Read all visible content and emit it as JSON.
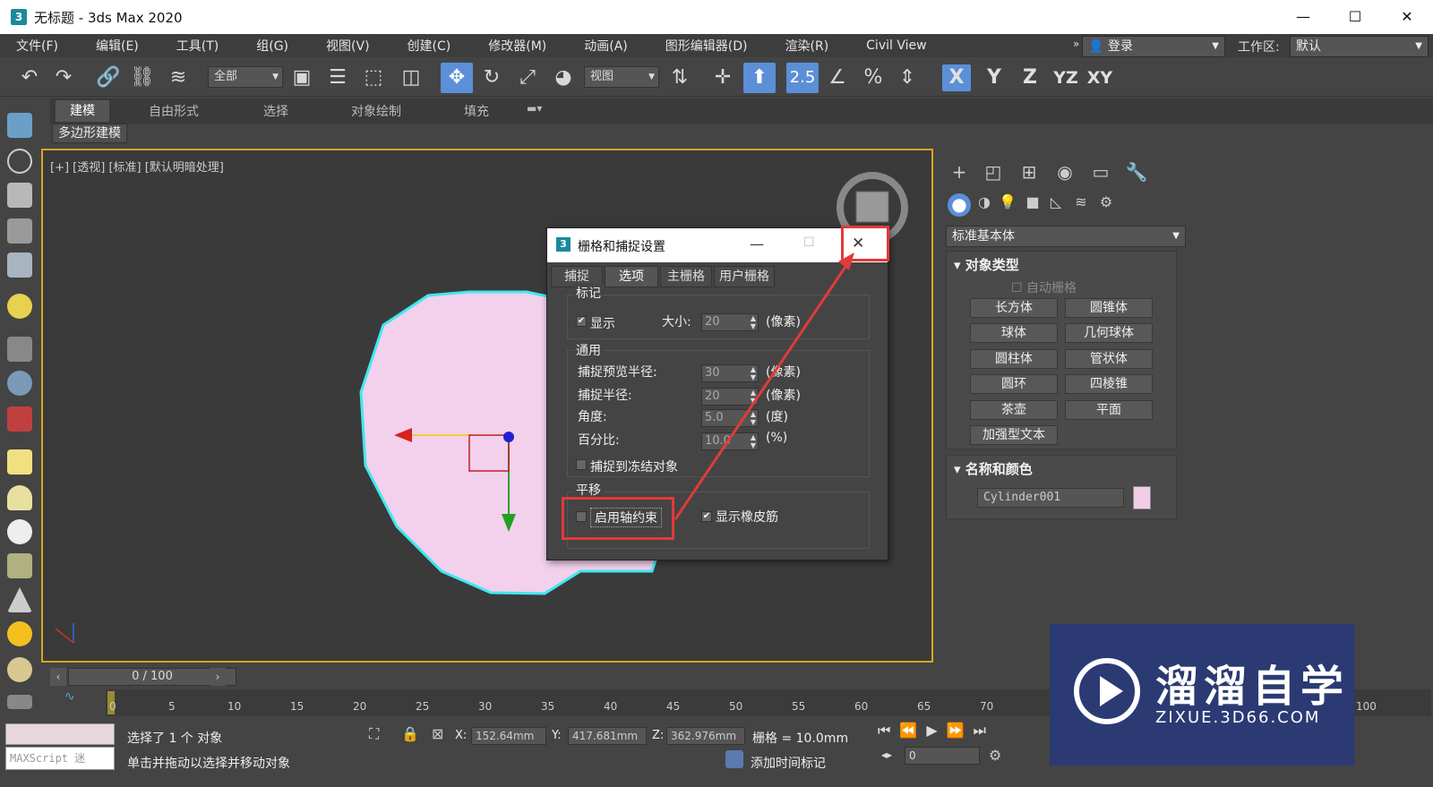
{
  "window": {
    "title": "无标题 - 3ds Max 2020",
    "app_icon": "3"
  },
  "menu": [
    "文件(F)",
    "编辑(E)",
    "工具(T)",
    "组(G)",
    "视图(V)",
    "创建(C)",
    "修改器(M)",
    "动画(A)",
    "图形编辑器(D)",
    "渲染(R)",
    "Civil View"
  ],
  "login": "登录",
  "workspace": {
    "label": "工作区:",
    "value": "默认"
  },
  "toolbar": {
    "selection_filter": "全部",
    "ref_coord": "视图",
    "snap_value": "2.5"
  },
  "axes": [
    "X",
    "Y",
    "Z",
    "YZ",
    "XY"
  ],
  "ribbon": {
    "tabs": [
      "建模",
      "自由形式",
      "选择",
      "对象绘制",
      "填充"
    ],
    "sub": "多边形建模"
  },
  "viewport": {
    "label": "[+] [透视] [标准] [默认明暗处理]"
  },
  "command_panel": {
    "category": "标准基本体",
    "object_type": {
      "header": "对象类型",
      "autogrid": "自动栅格",
      "buttons": [
        "长方体",
        "圆锥体",
        "球体",
        "几何球体",
        "圆柱体",
        "管状体",
        "圆环",
        "四棱锥",
        "茶壶",
        "平面",
        "加强型文本"
      ]
    },
    "name_color": {
      "header": "名称和颜色",
      "name": "Cylinder001",
      "color": "#f3cde8"
    }
  },
  "dialog": {
    "title": "栅格和捕捉设置",
    "tabs": [
      "捕捉",
      "选项",
      "主栅格",
      "用户栅格"
    ],
    "markers": {
      "group": "标记",
      "display_label": "显示",
      "display_checked": true,
      "size_label": "大小:",
      "size_value": "20",
      "size_unit": "(像素)"
    },
    "general": {
      "group": "通用",
      "preview_radius_label": "捕捉预览半径:",
      "preview_radius": "30",
      "preview_radius_unit": "(像素)",
      "snap_radius_label": "捕捉半径:",
      "snap_radius": "20",
      "snap_radius_unit": "(像素)",
      "angle_label": "角度:",
      "angle": "5.0",
      "angle_unit": "(度)",
      "percent_label": "百分比:",
      "percent": "10.0",
      "percent_unit": "(%)",
      "frozen_label": "捕捉到冻结对象"
    },
    "translation": {
      "group": "平移",
      "axis_constraint": "启用轴约束",
      "rubber_band": "显示橡皮筋",
      "rubber_band_checked": true
    }
  },
  "timeline": {
    "slider": "0 / 100",
    "ticks": [
      "0",
      "5",
      "10",
      "15",
      "20",
      "25",
      "30",
      "35",
      "40",
      "45",
      "50",
      "55",
      "60",
      "65",
      "70",
      "100"
    ]
  },
  "status": {
    "selected": "选择了 1 个 对象",
    "hint": "单击并拖动以选择并移动对象",
    "maxscript": "MAXScript 迷",
    "x_label": "X:",
    "x": "152.64mm",
    "y_label": "Y:",
    "y": "417.681mm",
    "z_label": "Z:",
    "z": "362.976mm",
    "grid": "栅格 = 10.0mm",
    "add_time_tag": "添加时间标记",
    "frame": "0"
  },
  "watermark": {
    "main": "溜溜自学",
    "sub": "ZIXUE.3D66.COM"
  },
  "colors": {
    "object_fill": "#f3d0ec",
    "object_edge": "#3ee8f0",
    "highlight": "#e23a3a",
    "active_tool": "#5b8fd8"
  }
}
